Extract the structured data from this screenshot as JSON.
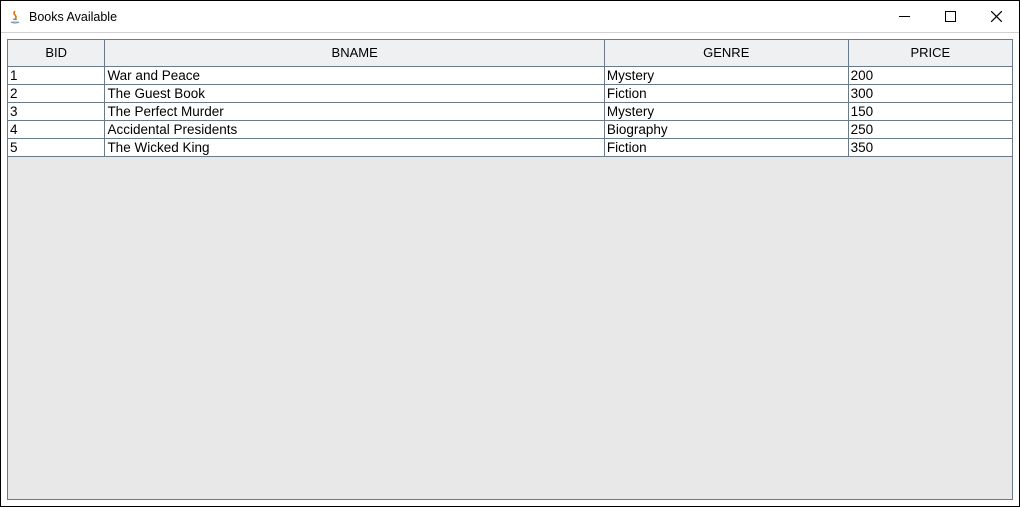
{
  "window": {
    "title": "Books Available"
  },
  "table": {
    "headers": [
      "BID",
      "BNAME",
      "GENRE",
      "PRICE"
    ],
    "rows": [
      {
        "bid": "1",
        "bname": "War and Peace",
        "genre": "Mystery",
        "price": "200"
      },
      {
        "bid": "2",
        "bname": "The Guest Book",
        "genre": "Fiction",
        "price": "300"
      },
      {
        "bid": "3",
        "bname": "The Perfect Murder",
        "genre": "Mystery",
        "price": "150"
      },
      {
        "bid": "4",
        "bname": "Accidental Presidents",
        "genre": "Biography",
        "price": "250"
      },
      {
        "bid": "5",
        "bname": "The Wicked King",
        "genre": "Fiction",
        "price": "350"
      }
    ]
  }
}
